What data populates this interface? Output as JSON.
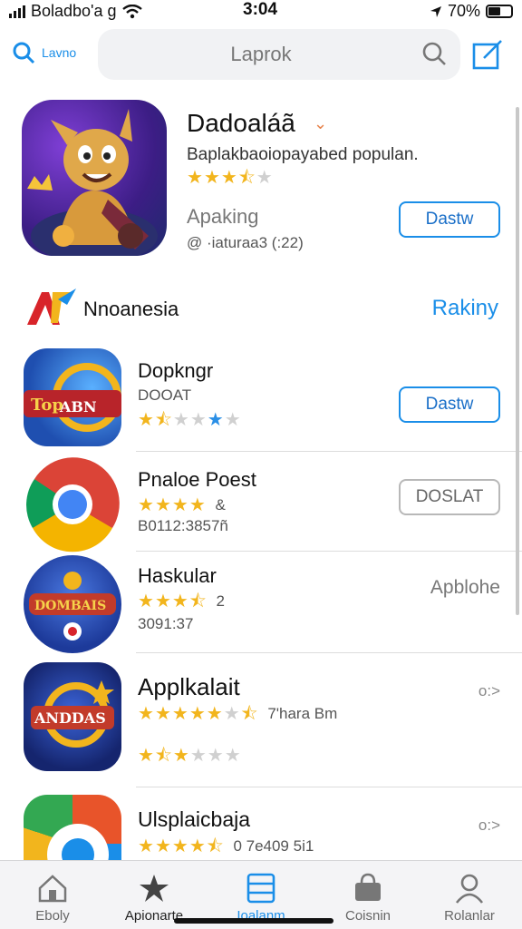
{
  "status": {
    "carrier": "Boladbo'a g",
    "time": "3:04",
    "battery": "70%"
  },
  "search": {
    "left_label": "Lavno",
    "placeholder": "Laprok"
  },
  "featured": {
    "title": "Dadoaláã",
    "subtitle": "Baplakbaoiopayabed populan.",
    "rating": 3.5,
    "category": "Apaking",
    "meta": "@ ·iaturaa3 (:22)",
    "button": "Dastw"
  },
  "section": {
    "title": "Nnoanesia",
    "link": "Rakiny"
  },
  "apps": [
    {
      "title": "Dopkngr",
      "line2": "DOOAT",
      "rating_text": "",
      "line3": "",
      "action": "Dastw",
      "action_type": "button"
    },
    {
      "title": "Pnaloe Poest",
      "line2": "",
      "rating_text": "&",
      "line3": "B0112:3857ñ",
      "action": "DOSLAT",
      "action_type": "button-gray"
    },
    {
      "title": "Haskular",
      "line2": "",
      "rating_text": "2",
      "line3": "3091:37",
      "action": "Apblohe",
      "action_type": "text"
    },
    {
      "title": "Applkalait",
      "line2": "",
      "rating_text": "7'hara Bm",
      "line3": "",
      "action": "o:>",
      "action_type": "chevron"
    },
    {
      "title": "Ulsplaicbaja",
      "line2": "",
      "rating_text": "0 7е409 5i1",
      "line3": "",
      "action": "o:>",
      "action_type": "chevron"
    }
  ],
  "tabs": [
    {
      "label": "Eboly",
      "icon": "home-icon"
    },
    {
      "label": "Apionarte",
      "icon": "star-icon"
    },
    {
      "label": "Ioalanm",
      "icon": "apps-icon",
      "active": true
    },
    {
      "label": "Coisnin",
      "icon": "bag-icon"
    },
    {
      "label": "Rolanlar",
      "icon": "person-icon"
    }
  ],
  "colors": {
    "accent": "#1a8ee8",
    "star": "#f2b51d"
  }
}
